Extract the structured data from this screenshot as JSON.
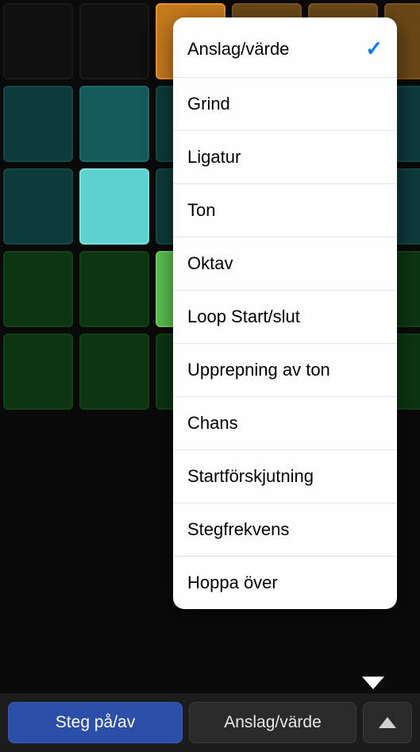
{
  "popover": {
    "items": [
      {
        "label": "Anslag/värde",
        "selected": true
      },
      {
        "label": "Grind",
        "selected": false
      },
      {
        "label": "Ligatur",
        "selected": false
      },
      {
        "label": "Ton",
        "selected": false
      },
      {
        "label": "Oktav",
        "selected": false
      },
      {
        "label": "Loop Start/slut",
        "selected": false
      },
      {
        "label": "Upprepning av ton",
        "selected": false
      },
      {
        "label": "Chans",
        "selected": false
      },
      {
        "label": "Startförskjutning",
        "selected": false
      },
      {
        "label": "Stegfrekvens",
        "selected": false
      },
      {
        "label": "Hoppa över",
        "selected": false
      }
    ]
  },
  "toolbar": {
    "step_toggle_label": "Steg på/av",
    "mode_label": "Anslag/värde"
  },
  "grid": {
    "rows": [
      [
        "dark",
        "dark",
        "orange",
        "orange-dim",
        "orange-dim",
        "orange-dim"
      ],
      [
        "teal-dark",
        "teal-med",
        "teal-dark",
        "teal-dark",
        "teal-dark",
        "teal-dark"
      ],
      [
        "teal-dark",
        "cyan-bright",
        "teal-dark",
        "teal-dark",
        "teal-dark",
        "teal-dark"
      ],
      [
        "green-dark",
        "green-dark",
        "green-bright",
        "green-dark",
        "green-dark",
        "green-dark"
      ],
      [
        "green-dark",
        "green-dark",
        "green-dark",
        "green-dark",
        "green-dark",
        "green-dark"
      ]
    ]
  }
}
